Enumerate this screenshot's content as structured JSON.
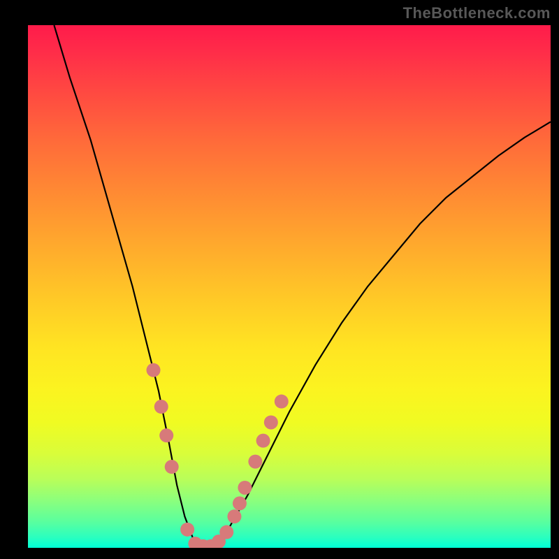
{
  "watermark": "TheBottleneck.com",
  "chart_data": {
    "type": "line",
    "title": "",
    "xlabel": "",
    "ylabel": "",
    "xlim": [
      0,
      100
    ],
    "ylim": [
      0,
      100
    ],
    "curve": {
      "name": "bottleneck-curve",
      "x": [
        5,
        8,
        12,
        16,
        20,
        23,
        25,
        27,
        28.5,
        30,
        31.5,
        33,
        35,
        38,
        42,
        46,
        50,
        55,
        60,
        65,
        70,
        75,
        80,
        85,
        90,
        95,
        100
      ],
      "y": [
        100,
        90,
        78,
        64,
        50,
        38,
        30,
        20,
        12,
        6,
        2,
        0,
        0,
        3,
        10,
        18,
        26,
        35,
        43,
        50,
        56,
        62,
        67,
        71,
        75,
        78.5,
        81.5
      ]
    },
    "highlight_points": {
      "name": "highlight-dots",
      "color": "#d77a7a",
      "points": [
        {
          "x": 24.0,
          "y": 34.0
        },
        {
          "x": 25.5,
          "y": 27.0
        },
        {
          "x": 26.5,
          "y": 21.5
        },
        {
          "x": 27.5,
          "y": 15.5
        },
        {
          "x": 30.5,
          "y": 3.5
        },
        {
          "x": 32.0,
          "y": 0.8
        },
        {
          "x": 33.5,
          "y": 0.3
        },
        {
          "x": 35.0,
          "y": 0.3
        },
        {
          "x": 36.5,
          "y": 1.2
        },
        {
          "x": 38.0,
          "y": 3.0
        },
        {
          "x": 39.5,
          "y": 6.0
        },
        {
          "x": 40.5,
          "y": 8.5
        },
        {
          "x": 41.5,
          "y": 11.5
        },
        {
          "x": 43.5,
          "y": 16.5
        },
        {
          "x": 45.0,
          "y": 20.5
        },
        {
          "x": 46.5,
          "y": 24.0
        },
        {
          "x": 48.5,
          "y": 28.0
        }
      ]
    }
  }
}
